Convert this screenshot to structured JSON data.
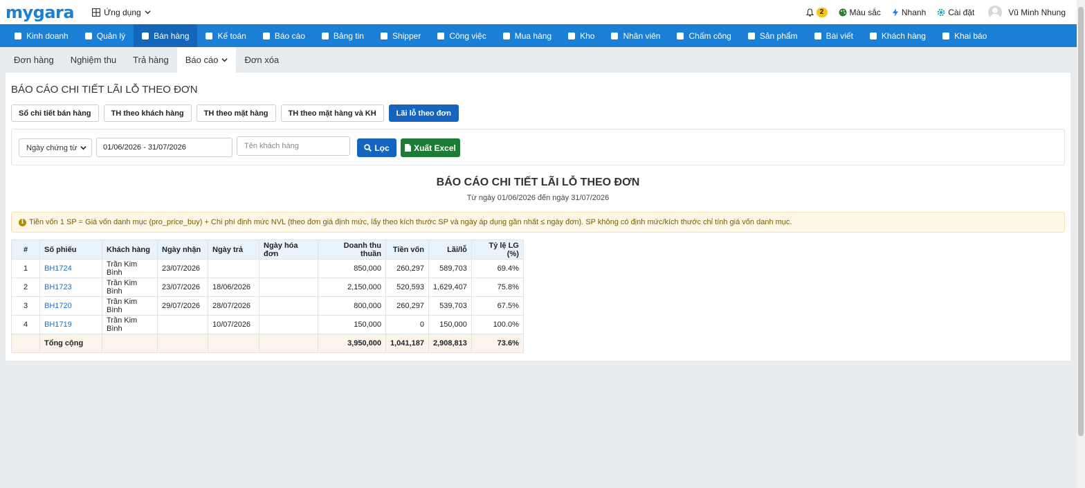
{
  "brand": {
    "logo": "mygara"
  },
  "topbar": {
    "apps_label": "Ứng dụng",
    "notifications_count": "2",
    "color_label": "Màu sắc",
    "quick_label": "Nhanh",
    "settings_label": "Cài đặt",
    "user_name": "Vũ Minh Nhung"
  },
  "nav": {
    "items": [
      {
        "label": "Kinh doanh",
        "icon": "briefcase-icon"
      },
      {
        "label": "Quản lý",
        "icon": "id-card-icon"
      },
      {
        "label": "Bán hàng",
        "icon": "cart-icon"
      },
      {
        "label": "Kế toán",
        "icon": "dollar-icon"
      },
      {
        "label": "Báo cáo",
        "icon": "pie-chart-icon"
      },
      {
        "label": "Bảng tin",
        "icon": "home-icon"
      },
      {
        "label": "Shipper",
        "icon": "truck-icon"
      },
      {
        "label": "Công việc",
        "icon": "calendar-icon"
      },
      {
        "label": "Mua hàng",
        "icon": "basket-icon"
      },
      {
        "label": "Kho",
        "icon": "warehouse-icon"
      },
      {
        "label": "Nhân viên",
        "icon": "user-icon"
      },
      {
        "label": "Chấm công",
        "icon": "calendar-icon"
      },
      {
        "label": "Sản phẩm",
        "icon": "box-icon"
      },
      {
        "label": "Bài viết",
        "icon": "newspaper-icon"
      },
      {
        "label": "Khách hàng",
        "icon": "smile-icon"
      },
      {
        "label": "Khai báo",
        "icon": "list-icon"
      }
    ],
    "active_index": 2
  },
  "subtabs": {
    "items": [
      "Đơn hàng",
      "Nghiệm thu",
      "Trả hàng",
      "Báo cáo",
      "Đơn xóa"
    ],
    "active_index": 3
  },
  "page": {
    "title": "BÁO CÁO CHI TIẾT LÃI LỖ THEO ĐƠN"
  },
  "report_buttons": {
    "items": [
      "Sổ chi tiết bán hàng",
      "TH theo khách hàng",
      "TH theo mặt hàng",
      "TH theo mặt hàng và KH",
      "Lãi lỗ theo đơn"
    ],
    "active_index": 4
  },
  "filter": {
    "date_type": "Ngày chứng từ",
    "date_range": "01/06/2026 - 31/07/2026",
    "customer_placeholder": "Tên khách hàng",
    "filter_label": "Lọc",
    "export_label": "Xuất Excel"
  },
  "report": {
    "title": "BÁO CÁO CHI TIẾT LÃI LỖ THEO ĐƠN",
    "subtitle": "Từ ngày 01/06/2026 đến ngày 31/07/2026",
    "note": "Tiền vốn 1 SP = Giá vốn danh mục (pro_price_buy) + Chi phí định mức NVL (theo đơn giá định mức, lấy theo kích thước SP và ngày áp dụng gần nhất ≤ ngày đơn). SP không có định mức/kích thước chỉ tính giá vốn danh mục."
  },
  "table": {
    "headers": [
      "#",
      "Số phiếu",
      "Khách hàng",
      "Ngày nhận",
      "Ngày trả",
      "Ngày hóa đơn",
      "Doanh thu thuần",
      "Tiền vốn",
      "Lãi/lỗ",
      "Tỷ lệ LG (%)"
    ],
    "rows": [
      {
        "no": "1",
        "code": "BH1724",
        "customer": "Trần Kim Bình",
        "received": "23/07/2026",
        "returned": "",
        "invoice": "",
        "revenue": "850,000",
        "cost": "260,297",
        "profit": "589,703",
        "ratio": "69.4%"
      },
      {
        "no": "2",
        "code": "BH1723",
        "customer": "Trần Kim Bình",
        "received": "23/07/2026",
        "returned": "18/06/2026",
        "invoice": "",
        "revenue": "2,150,000",
        "cost": "520,593",
        "profit": "1,629,407",
        "ratio": "75.8%"
      },
      {
        "no": "3",
        "code": "BH1720",
        "customer": "Trần Kim Bình",
        "received": "29/07/2026",
        "returned": "28/07/2026",
        "invoice": "",
        "revenue": "800,000",
        "cost": "260,297",
        "profit": "539,703",
        "ratio": "67.5%"
      },
      {
        "no": "4",
        "code": "BH1719",
        "customer": "Trần Kim Bình",
        "received": "",
        "returned": "10/07/2026",
        "invoice": "",
        "revenue": "150,000",
        "cost": "0",
        "profit": "150,000",
        "ratio": "100.0%"
      }
    ],
    "total": {
      "label": "Tổng cộng",
      "revenue": "3,950,000",
      "cost": "1,041,187",
      "profit": "2,908,813",
      "ratio": "73.6%"
    }
  },
  "colors": {
    "primary": "#1b7fd6",
    "nav_active": "#1565b8",
    "button_primary": "#1565c0",
    "button_excel": "#1e7b34",
    "header_bg": "#e8f3fb",
    "total_bg": "#fdf5ec",
    "note_bg": "#fff8e6"
  }
}
